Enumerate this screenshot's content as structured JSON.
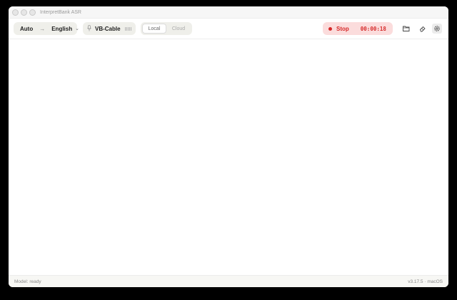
{
  "window": {
    "title": "InterpretBank ASR"
  },
  "toolbar": {
    "source_lang": "Auto",
    "target_lang": "English",
    "input_device": "VB-Cable",
    "mode_options": [
      "Local",
      "Cloud"
    ],
    "active_mode": "Local",
    "stop_label": "Stop",
    "timer": "00:00:18"
  },
  "colors": {
    "recording_accent": "#d62a2a",
    "recording_bg": "#fbdcdc",
    "pill_bg": "#efefea"
  },
  "icons": [
    "arrow-right-icon",
    "chevron-down-icon",
    "microphone-icon",
    "audio-meter-icon",
    "record-dot-icon",
    "folder-icon",
    "eraser-icon",
    "gear-icon"
  ],
  "status": {
    "model": "Model: ready",
    "version": "v3.17.5 · macOS"
  }
}
